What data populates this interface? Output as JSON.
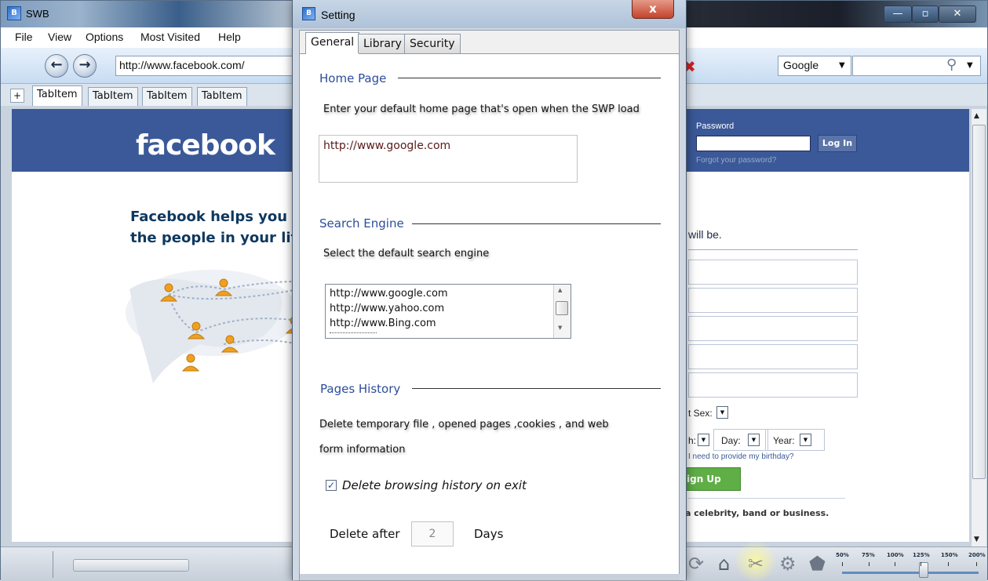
{
  "browser": {
    "title": "SWB",
    "menu": [
      "File",
      "View",
      "Options",
      "Most Visited",
      "Help"
    ],
    "url": "http://www.facebook.com/",
    "search_engine": "Google",
    "tabs": [
      "TabItem",
      "TabItem",
      "TabItem",
      "TabItem"
    ],
    "add_tab": "+",
    "zoom_levels": [
      "50%",
      "75%",
      "100%",
      "125%",
      "150%",
      "200%"
    ]
  },
  "page": {
    "logo": "facebook",
    "password_label": "Password",
    "login_button": "Log In",
    "forgot_password": "Forgot your password?",
    "tagline_line1": "Facebook helps you c",
    "tagline_line2": "the people in your life",
    "will_be": "will be.",
    "sex_label": "t Sex:",
    "month_label": "h:",
    "day_label": "Day:",
    "year_label": "Year:",
    "birthday_link": "I need to provide my birthday?",
    "signup_button": "ign Up",
    "celebrity_text": "a celebrity, band or business."
  },
  "dialog": {
    "title": "Setting",
    "close": "x",
    "tabs": [
      "General",
      "Library",
      "Security"
    ],
    "home_page": {
      "heading": "Home Page",
      "description": "Enter your default home page that's open when the SWP load",
      "value": "http://www.google.com"
    },
    "search_engine": {
      "heading": "Search Engine",
      "description": "Select the default search engine",
      "options": [
        "http://www.google.com",
        "http://www.yahoo.com",
        "http://www.Bing.com"
      ]
    },
    "pages_history": {
      "heading": "Pages History",
      "description_line1": "Delete temporary file , opened pages ,cookies , and web",
      "description_line2": "form information",
      "checkbox_label": "Delete browsing history on exit",
      "checkbox_checked": true,
      "delete_after_label": "Delete after",
      "days_value": "2",
      "days_label": "Days"
    }
  }
}
